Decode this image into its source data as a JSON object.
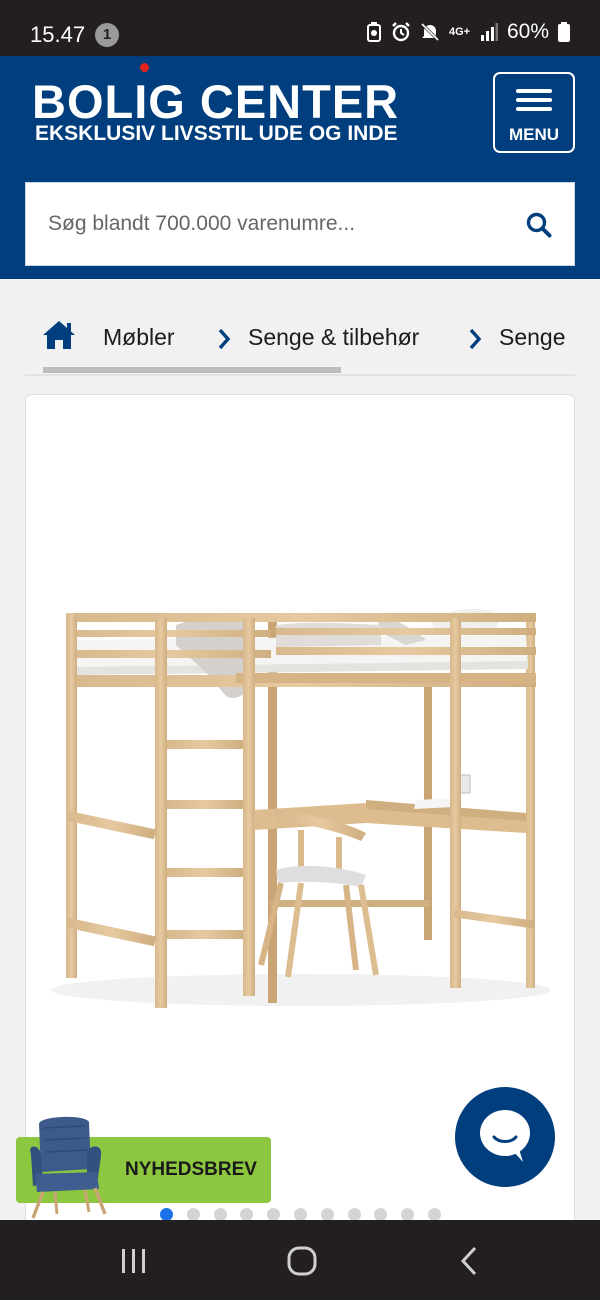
{
  "status_bar": {
    "time": "15.47",
    "notification_count": "1",
    "network": "4G+",
    "battery": "60%"
  },
  "header": {
    "logo_title": "BOLIG CENTER",
    "logo_tagline": "EKSKLUSIV LIVSSTIL UDE OG INDE",
    "menu_label": "MENU",
    "brand_color": "#003e7e",
    "accent_color": "#e2231a"
  },
  "search": {
    "placeholder": "Søg blandt 700.000 varenumre..."
  },
  "breadcrumb": {
    "home_icon": "home-icon",
    "items": [
      "Møbler",
      "Senge & tilbehør",
      "Senge"
    ]
  },
  "product": {
    "image_icon": "loft-bed-with-desk-image"
  },
  "carousel": {
    "total_slides": 11,
    "active_index": 0,
    "active_color": "#1a73e8"
  },
  "newsletter": {
    "label": "NYHEDSBREV",
    "button_color": "#8dc63f"
  },
  "chat": {
    "icon": "chat-bubble-icon"
  },
  "nav_bar": {
    "buttons": [
      "recent-apps-icon",
      "home-circle-icon",
      "back-icon"
    ]
  }
}
